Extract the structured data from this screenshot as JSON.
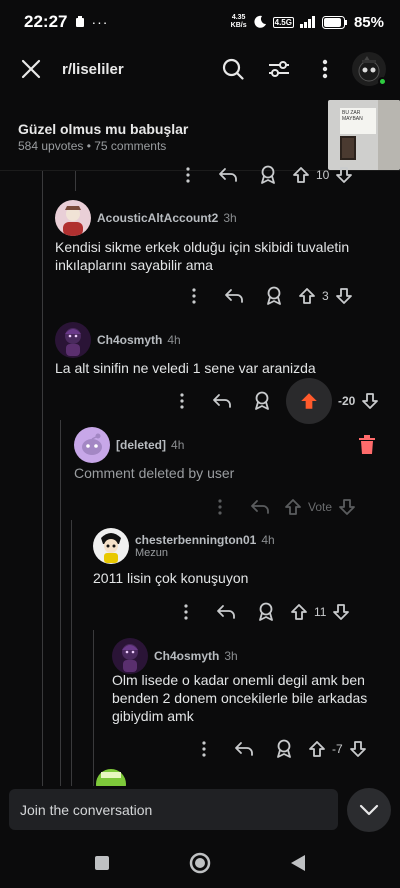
{
  "status": {
    "time": "22:27",
    "speed_value": "4.35",
    "speed_unit": "KB/s",
    "network": "4.5G",
    "battery": "85%"
  },
  "header": {
    "subreddit": "r/liseliler"
  },
  "post": {
    "title": "Güzel olmus mu babuşlar",
    "meta": "584 upvotes • 75 comments",
    "thumb_text": "BU ZAR MAYBAN"
  },
  "top_row": {
    "count": "10"
  },
  "comments": [
    {
      "user": "AcousticAltAccount2",
      "time": "3h",
      "text": "Kendisi sikme erkek olduğu için skibidi tuvaletin inkılaplarını sayabilir ama",
      "votes": "3"
    },
    {
      "user": "Ch4osmyth",
      "time": "4h",
      "text": "La alt sinifin ne veledi 1 sene var aranizda",
      "votes": "-20"
    },
    {
      "user": "[deleted]",
      "time": "4h",
      "text": "Comment deleted by user",
      "votes": "Vote"
    },
    {
      "user": "chesterbennington01",
      "time": "4h",
      "flair": "Mezun",
      "text": "2011 lisin çok konuşuyon",
      "votes": "11"
    },
    {
      "user": "Ch4osmyth",
      "time": "3h",
      "text": "Olm lisede o kadar onemli degil amk ben benden 2 donem oncekilerle bile arkadas gibiydim amk",
      "votes": "-7"
    }
  ],
  "composer": {
    "placeholder": "Join the conversation"
  },
  "colors": {
    "downvote_red": "#ff5a2c",
    "bg": "#0b0b0c",
    "online": "#2ecc40"
  }
}
